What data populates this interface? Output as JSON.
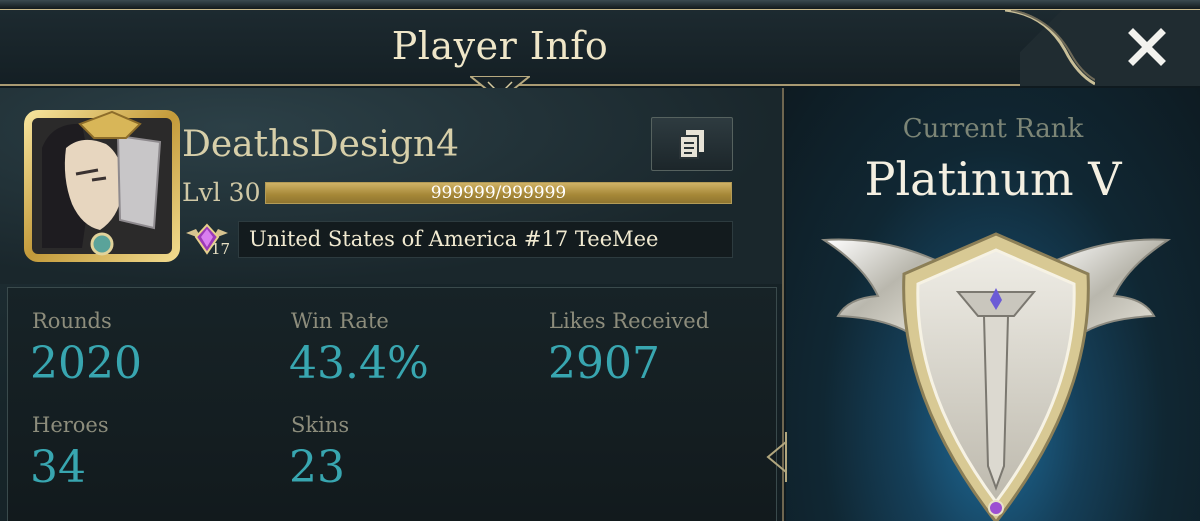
{
  "header": {
    "title": "Player Info",
    "close_icon": "close-icon"
  },
  "player": {
    "name": "DeathsDesign4",
    "level_label": "Lvl 30",
    "xp_text": "999999/999999",
    "xp_progress": 1.0,
    "region_rank_number": "17",
    "region_text": "United States of America #17 TeeMee"
  },
  "stats": {
    "rounds_label": "Rounds",
    "rounds_value": "2020",
    "win_rate_label": "Win Rate",
    "win_rate_value": "43.4%",
    "likes_label": "Likes Received",
    "likes_value": "2907",
    "heroes_label": "Heroes",
    "heroes_value": "34",
    "skins_label": "Skins",
    "skins_value": "23"
  },
  "rank": {
    "label": "Current Rank",
    "name": "Platinum V"
  },
  "colors": {
    "stat_value": "#38a6b0",
    "xp_bar": "#b39b57",
    "title_text": "#efe6c8"
  }
}
